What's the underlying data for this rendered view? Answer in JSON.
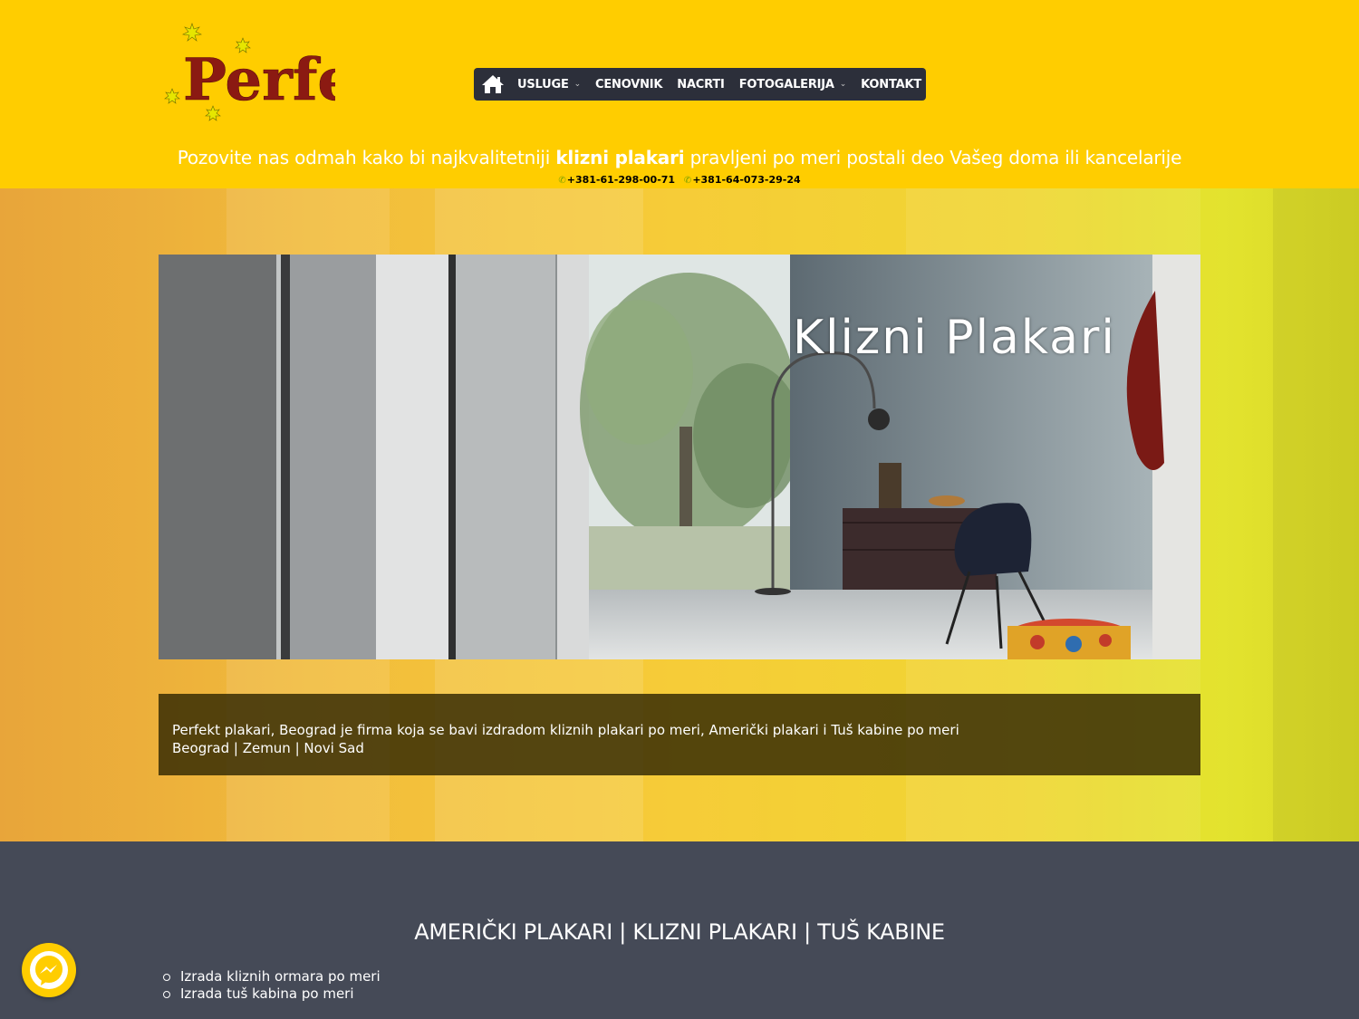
{
  "brand": {
    "logo_text": "Perfekt",
    "colors": {
      "header_bg": "#ffcd00",
      "nav_bg": "#2c2f3a",
      "dark_bg": "#454a57",
      "logo_red": "#8b1a12"
    }
  },
  "nav": {
    "home_icon": "home-icon",
    "items": [
      {
        "label": "USLUGE",
        "has_dropdown": true
      },
      {
        "label": "CENOVNIK",
        "has_dropdown": false
      },
      {
        "label": "NACRTI",
        "has_dropdown": false
      },
      {
        "label": "FOTOGALERIJA",
        "has_dropdown": true
      },
      {
        "label": "KONTAKT",
        "has_dropdown": false
      }
    ]
  },
  "tagline": {
    "before": "Pozovite nas odmah kako bi najkvalitetniji ",
    "bold": "klizni plakari",
    "after": " pravljeni po meri postali deo Vašeg doma ili kancelarije"
  },
  "phones": [
    "+381-61-298-00-71",
    "+381-64-073-29-24"
  ],
  "banner": {
    "title": "Klizni Plakari"
  },
  "infobox": {
    "line1": "Perfekt plakari, Beograd je firma koja se bavi izdradom kliznih plakari po meri, Američki plakari i Tuš kabine po meri",
    "line2": "Beograd | Zemun | Novi Sad"
  },
  "section": {
    "heading": "AMERIČKI PLAKARI | KLIZNI PLAKARI | TUŠ KABINE",
    "list": [
      "Izrada kliznih ormara po meri",
      "Izrada tuš kabina po meri"
    ]
  },
  "chat": {
    "icon": "messenger-icon"
  }
}
